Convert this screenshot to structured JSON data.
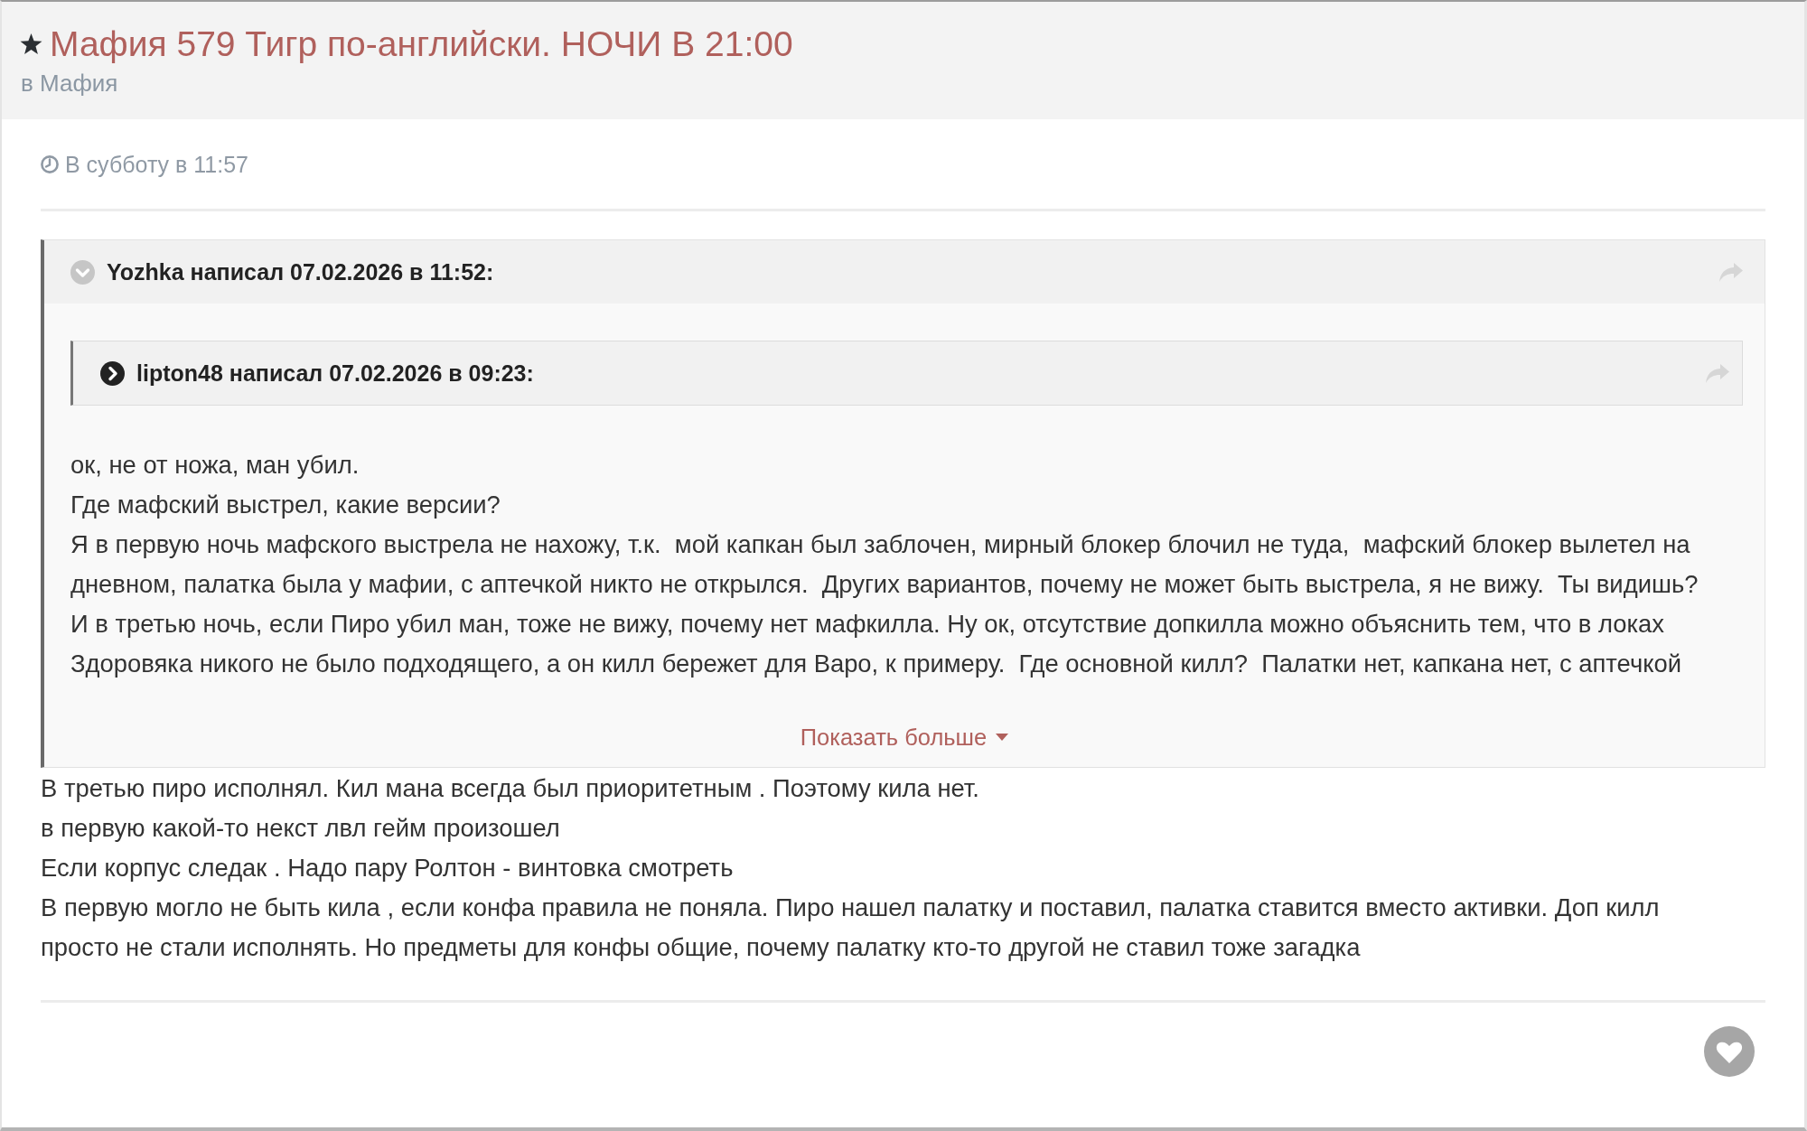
{
  "thread": {
    "title": "Мафия 579 Тигр по-английски. НОЧИ В 21:00",
    "forum": "в Мафия"
  },
  "post": {
    "date": "В субботу в 11:57",
    "quote": {
      "author": "Yozhka написал 07.02.2026 в 11:52:",
      "expanded": true,
      "nested_quote": {
        "author": "lipton48 написал 07.02.2026 в 09:23:",
        "expanded": false
      },
      "paragraphs": [
        "ок, не от ножа, ман убил.",
        "Где мафский выстрел, какие версии?",
        "Я в первую ночь мафского выстрела не нахожу, т.к.  мой капкан был заблочен, мирный блокер блочил не туда,  мафский блокер вылетел на дневном, палатка была у мафии, с аптечкой никто не открылся.  Других вариантов, почему не может быть выстрела, я не вижу.  Ты видишь?",
        "И в третью ночь, если Пиро убил ман, тоже не вижу, почему нет мафкилла. Ну ок, отсутствие допкилла можно объяснить тем, что в локах Здоровяка никого не было подходящего, а он килл бережет для Варо, к примеру.  Где основной килл?  Палатки нет, капкана нет, с аптечкой"
      ],
      "show_more": "Показать больше"
    },
    "paragraphs": [
      "В третью пиро исполнял. Кил мана всегда был приоритетным . Поэтому кила нет.",
      "в первую какой-то некст лвл гейм произошел",
      "Если корпус следак . Надо пару Ролтон - винтовка смотреть",
      "В первую могло не быть кила , если конфа правила не поняла. Пиро нашел палатку и поставил, палатка ставится вместо активки. Доп килл просто не стали исполнять. Но предметы для конфы общие, почему палатку кто-то другой не ставил тоже загадка"
    ]
  }
}
